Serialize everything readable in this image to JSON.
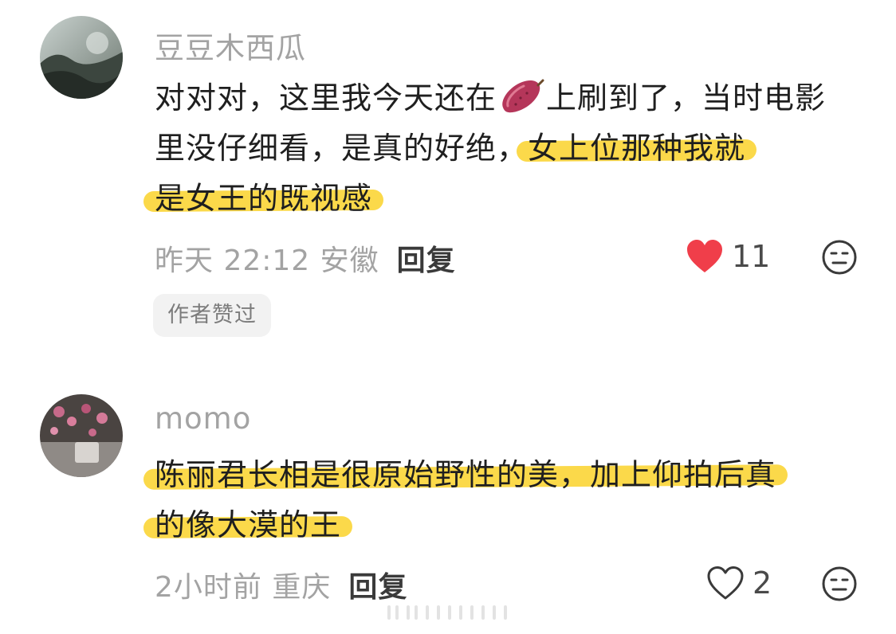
{
  "comments": [
    {
      "username": "豆豆木西瓜",
      "text_before_emoji": "对对对，这里我今天还在",
      "text_after_emoji": "上刷到了，当时电影里没仔细看，是真的好绝，",
      "highlight_line1": "女上位那种我就",
      "highlight_line2": "是女王的既视感",
      "emoji_icon": "sweet-potato-icon",
      "time_location": "昨天 22:12 安徽",
      "reply_label": "回复",
      "like_count": "11",
      "liked": true,
      "badge": "作者赞过"
    },
    {
      "username": "momo",
      "highlight_line1": "陈丽君长相是很原始野性的美，加上仰拍后真",
      "highlight_line2": "的像大漠的王",
      "time_location": "2小时前 重庆",
      "reply_label": "回复",
      "like_count": "2",
      "liked": false
    }
  ],
  "colors": {
    "highlight": "#fbd94a",
    "like_red": "#f03e4a",
    "meta_gray": "#a3a3a3"
  }
}
